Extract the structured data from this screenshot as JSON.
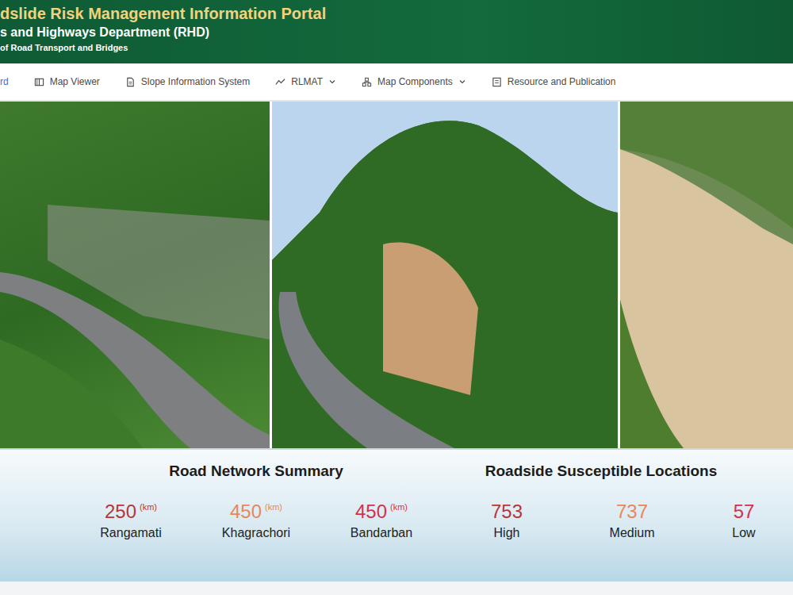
{
  "header": {
    "title": "dslide Risk Management Information Portal",
    "department": "s and Highways Department (RHD)",
    "ministry": "of Road Transport and Bridges"
  },
  "nav": [
    {
      "label": "rd",
      "dropdown": false,
      "selected": true
    },
    {
      "label": "Map Viewer",
      "dropdown": false,
      "selected": false
    },
    {
      "label": "Slope Information System",
      "dropdown": false,
      "selected": false
    },
    {
      "label": "RLMAT",
      "dropdown": true,
      "selected": false
    },
    {
      "label": "Map Components",
      "dropdown": true,
      "selected": false
    },
    {
      "label": "Resource and Publication",
      "dropdown": false,
      "selected": false
    }
  ],
  "summary": {
    "title": "Road Network Summary",
    "items": [
      {
        "value": "250",
        "unit": "(km)",
        "label": "Rangamati",
        "color": "#b8353a"
      },
      {
        "value": "450",
        "unit": "(km)",
        "label": "Khagrachori",
        "color": "#e8875c"
      },
      {
        "value": "450",
        "unit": "(km)",
        "label": "Bandarban",
        "color": "#d3314d"
      }
    ]
  },
  "susceptible": {
    "title": "Roadside Susceptible Locations",
    "items": [
      {
        "value": "753",
        "label": "High",
        "color": "#b8353a"
      },
      {
        "value": "737",
        "label": "Medium",
        "color": "#e8875c"
      },
      {
        "value": "57",
        "label": "Low",
        "color": "#d3314d"
      }
    ]
  }
}
